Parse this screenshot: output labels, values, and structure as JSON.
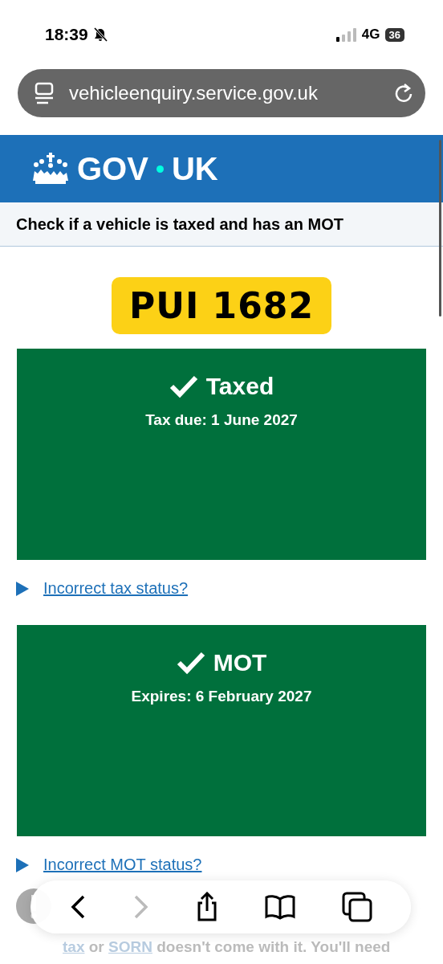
{
  "status_bar": {
    "time": "18:39",
    "network": "4G",
    "battery": "36"
  },
  "address_bar": {
    "url": "vehicleenquiry.service.gov.uk"
  },
  "header": {
    "logo_left": "GOV",
    "logo_right": "UK"
  },
  "service_name": "Check if a vehicle is taxed and has an MOT",
  "registration": "PUI 1682",
  "statuses": [
    {
      "title": "Taxed",
      "detail": "Tax due: 1 June 2027",
      "valid": true,
      "link": "Incorrect tax status?"
    },
    {
      "title": "MOT",
      "detail": "Expires: 6 February 2027",
      "valid": true,
      "link": "Incorrect MOT status?"
    }
  ],
  "warning": {
    "prefix_link": "tax",
    "middle": " or ",
    "second_link": "SORN",
    "suffix": " doesn't come with it. You'll need"
  },
  "toolbar": {
    "back_disabled": false,
    "forward_disabled": true
  }
}
